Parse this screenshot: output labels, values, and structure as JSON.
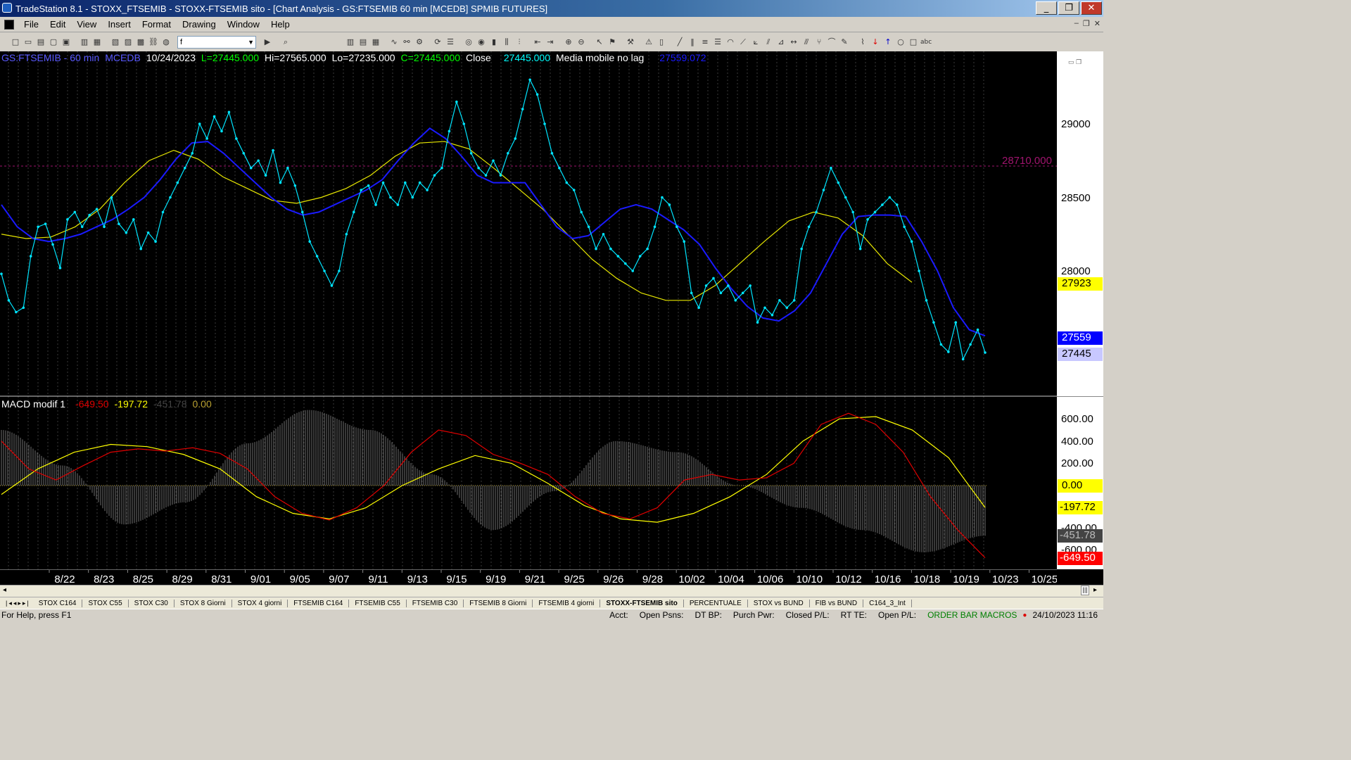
{
  "window": {
    "title": "TradeStation 8.1 - STOXX_FTSEMIB - STOXX-FTSEMIB sito - [Chart Analysis - GS:FTSEMIB  60 min  [MCEDB] SPMIB FUTURES]"
  },
  "menu": [
    "File",
    "Edit",
    "View",
    "Insert",
    "Format",
    "Drawing",
    "Window",
    "Help"
  ],
  "toolbar": {
    "symbol_value": "f"
  },
  "price_pane": {
    "symbol": "GS:FTSEMIB - 60 min",
    "exchange": "MCEDB",
    "date": "10/24/2023",
    "last": "L=27445.000",
    "high": "Hi=27565.000",
    "low": "Lo=27235.000",
    "close_eq": "C=27445.000",
    "close_label": "Close",
    "close_value": "27445.000",
    "ma_label": "Media mobile no lag",
    "ma_value": "27559.072",
    "hline_label": "28710.000",
    "axis_ticks": [
      "29000",
      "28500",
      "28000"
    ],
    "tags": [
      {
        "label": "27923",
        "bg": "#ffff00",
        "fg": "#000000"
      },
      {
        "label": "27559",
        "bg": "#0000ff",
        "fg": "#ffffff"
      },
      {
        "label": "27445",
        "bg": "#c8c8ff",
        "fg": "#000000"
      }
    ]
  },
  "macd_pane": {
    "title": "MACD modif 1",
    "v1": "-649.50",
    "v2": "-197.72",
    "v3": "-451.78",
    "v4": "0.00",
    "axis_ticks": [
      "600.00",
      "400.00",
      "200.00",
      "-400.00",
      "-600.00"
    ],
    "tags": [
      {
        "label": "0.00",
        "bg": "#ffff00",
        "fg": "#000000"
      },
      {
        "label": "-197.72",
        "bg": "#ffff00",
        "fg": "#000000"
      },
      {
        "label": "-451.78",
        "bg": "#444444",
        "fg": "#bbbbbb"
      },
      {
        "label": "-649.50",
        "bg": "#ff0000",
        "fg": "#ffffff"
      }
    ]
  },
  "x_labels": [
    "8/22",
    "8/23",
    "8/25",
    "8/29",
    "8/31",
    "9/01",
    "9/05",
    "9/07",
    "9/11",
    "9/13",
    "9/15",
    "9/19",
    "9/21",
    "9/25",
    "9/26",
    "9/28",
    "10/02",
    "10/04",
    "10/06",
    "10/10",
    "10/12",
    "10/16",
    "10/18",
    "10/19",
    "10/23",
    "10/25"
  ],
  "sheet_tabs": [
    "STOX C164",
    "STOX C55",
    "STOX  C30",
    "STOX  8 Giorni",
    "STOX 4 giorni",
    "FTSEMIB C164",
    "FTSEMIB C55",
    "FTSEMIB C30",
    "FTSEMIB  8 Giorni",
    "FTSEMIB  4 giorni",
    "STOXX-FTSEMIB sito",
    "PERCENTUALE",
    "STOX vs BUND",
    "FIB vs BUND",
    "C164_3_Int"
  ],
  "status": {
    "help": "For Help, press F1",
    "acct": "Acct:",
    "open_psns": "Open Psns:",
    "dt_bp": "DT BP:",
    "purch_pwr": "Purch Pwr:",
    "closed_pl": "Closed P/L:",
    "rt_te": "RT TE:",
    "open_pl": "Open P/L:",
    "macros": "ORDER BAR  MACROS",
    "datetime": "24/10/2023 11:16"
  },
  "colors": {
    "price_line": "#00e5ff",
    "ma_blue": "#1a1aff",
    "ma_yellow": "#e6e600",
    "macd_red": "#e00000",
    "macd_yellow": "#ffff00",
    "histogram": "#707070"
  },
  "chart_data": [
    {
      "type": "line",
      "pane": "price",
      "ylim": [
        27400,
        29250
      ],
      "series": [
        {
          "values": [
            27980,
            27800,
            27720,
            27750,
            28100,
            28300,
            28320,
            28180,
            28020,
            28350,
            28400,
            28300,
            28380,
            28420,
            28300,
            28500,
            28320,
            28260,
            28350,
            28150,
            28260,
            28200,
            28400,
            28500,
            28600,
            28700,
            28800,
            29000,
            28900,
            29050,
            28950,
            29080,
            28900,
            28800,
            28700,
            28750,
            28650,
            28820,
            28600,
            28700,
            28580,
            28400,
            28200,
            28100,
            28000,
            27900,
            28000,
            28250,
            28400,
            28550,
            28580,
            28450,
            28600,
            28500,
            28450,
            28600,
            28500,
            28600,
            28550,
            28650,
            28700,
            28950,
            29150,
            29000,
            28800,
            28700,
            28650,
            28750,
            28650,
            28800,
            28900,
            29100,
            29300,
            29200,
            29000,
            28800,
            28700,
            28600,
            28550,
            28400,
            28300,
            28150,
            28250,
            28150,
            28100,
            28050,
            28000,
            28100,
            28150,
            28300,
            28500,
            28450,
            28300,
            28200,
            27850,
            27750,
            27900,
            27950,
            27850,
            27900,
            27800,
            27850,
            27900,
            27650,
            27750,
            27700,
            27800,
            27750,
            27800,
            28150,
            28300,
            28400,
            28550,
            28700,
            28600,
            28500,
            28400,
            28150,
            28350,
            28400,
            28450,
            28500,
            28450,
            28300,
            28200,
            28000,
            27800,
            27650,
            27500,
            27450,
            27650,
            27400,
            27500,
            27600,
            27445
          ]
        },
        {
          "values": [
            28450,
            28300,
            28220,
            28200,
            28220,
            28250,
            28300,
            28350,
            28420,
            28500,
            28620,
            28760,
            28870,
            28880,
            28800,
            28700,
            28600,
            28500,
            28420,
            28380,
            28400,
            28450,
            28500,
            28550,
            28620,
            28750,
            28870,
            28970,
            28900,
            28780,
            28650,
            28600,
            28600,
            28600,
            28450,
            28300,
            28220,
            28240,
            28330,
            28420,
            28450,
            28420,
            28350,
            28280,
            28180,
            28020,
            27880,
            27760,
            27680,
            27660,
            27730,
            27850,
            28050,
            28250,
            28370,
            28380,
            28380,
            28370,
            28200,
            28000,
            27750,
            27600,
            27559
          ]
        },
        {
          "values": [
            28250,
            28220,
            28230,
            28300,
            28420,
            28600,
            28750,
            28820,
            28760,
            28640,
            28560,
            28480,
            28460,
            28500,
            28560,
            28650,
            28780,
            28870,
            28880,
            28830,
            28700,
            28560,
            28420,
            28250,
            28080,
            27950,
            27850,
            27800,
            27800,
            27900,
            28050,
            28200,
            28340,
            28400,
            28360,
            28240,
            28050,
            27923
          ]
        }
      ]
    },
    {
      "type": "line",
      "pane": "macd",
      "ylim": [
        -720,
        720
      ],
      "series": [
        {
          "values": [
            400,
            150,
            50,
            180,
            300,
            330,
            310,
            340,
            290,
            150,
            -100,
            -250,
            -310,
            -200,
            0,
            300,
            500,
            450,
            280,
            200,
            100,
            -100,
            -250,
            -300,
            -200,
            50,
            100,
            50,
            70,
            200,
            550,
            650,
            550,
            300,
            -100,
            -400,
            -649.5
          ]
        },
        {
          "values": [
            -80,
            150,
            300,
            370,
            350,
            280,
            150,
            -100,
            -250,
            -300,
            -200,
            0,
            150,
            270,
            200,
            20,
            -180,
            -300,
            -330,
            -250,
            -100,
            100,
            400,
            600,
            620,
            500,
            250,
            -197.72
          ]
        },
        {
          "values": [
            500,
            180,
            -350,
            -150,
            380,
            680,
            500,
            100,
            -400,
            -50,
            400,
            300,
            0,
            -200,
            -400,
            -600,
            -451.78
          ]
        }
      ]
    }
  ]
}
